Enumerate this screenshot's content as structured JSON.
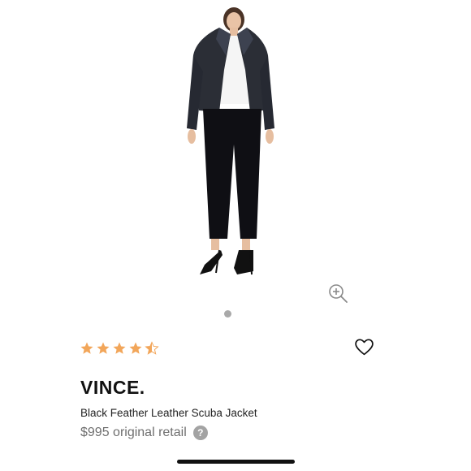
{
  "product": {
    "brand": "VINCE.",
    "name": "Black Feather Leather Scuba Jacket",
    "price": "$995 original retail",
    "rating": 4.5,
    "rating_max": 5,
    "image_index": 1,
    "image_count": 1
  },
  "icons": {
    "zoom": "zoom-in-icon",
    "favorite": "heart-outline-icon",
    "help": "question-mark-icon",
    "help_glyph": "?"
  },
  "colors": {
    "star": "#f2a65a",
    "dot_active": "#a9a9a9",
    "price": "#6f6f6f",
    "help_badge": "#a3a3a3"
  }
}
